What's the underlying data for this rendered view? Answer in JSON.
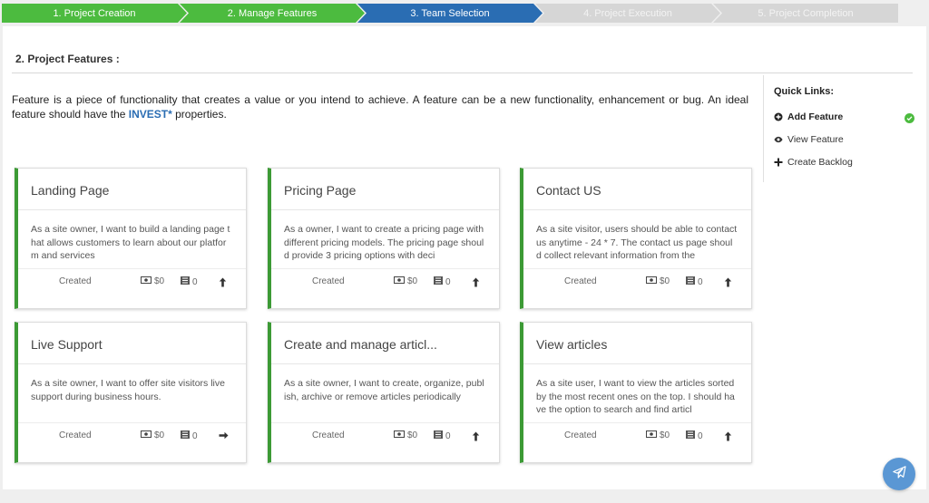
{
  "stepper": [
    {
      "label": "1. Project Creation",
      "state": "done"
    },
    {
      "label": "2. Manage Features",
      "state": "done"
    },
    {
      "label": "3. Team Selection",
      "state": "active"
    },
    {
      "label": "4. Project Execution",
      "state": "todo"
    },
    {
      "label": "5. Project Completion",
      "state": "todo"
    }
  ],
  "section": {
    "title": "2. Project Features :",
    "intro_before": "Feature is a piece of functionality that creates a value or you intend to achieve. A feature can be a new functionality, enhancement or bug. An ideal feature should have the ",
    "intro_link": "INVEST*",
    "intro_after": " properties."
  },
  "quick_links": {
    "title": "Quick Links:",
    "items": [
      {
        "label": "Add Feature",
        "icon": "plus-circle-icon",
        "checked": true
      },
      {
        "label": "View Feature",
        "icon": "eye-icon"
      },
      {
        "label": "Create Backlog",
        "icon": "plus-icon"
      }
    ]
  },
  "cards": [
    {
      "title": "Landing Page",
      "description": "As a site owner, I want to build a landing page that allows customers to learn about our platform and services",
      "status": "Created",
      "cost": "$0",
      "count": "0",
      "arrow": "up-arrow-icon"
    },
    {
      "title": "Pricing Page",
      "description": "As a owner, I want to create a pricing page with different pricing models. The pricing page should provide 3 pricing options with deci",
      "status": "Created",
      "cost": "$0",
      "count": "0",
      "arrow": "up-arrow-icon"
    },
    {
      "title": "Contact US",
      "description": "As a site visitor, users should be able to contact us anytime - 24 * 7. The contact us page should collect relevant information from the",
      "status": "Created",
      "cost": "$0",
      "count": "0",
      "arrow": "up-arrow-icon"
    },
    {
      "title": "Live Support",
      "description": "As a site owner, I want to offer site visitors live support during business hours.",
      "status": "Created",
      "cost": "$0",
      "count": "0",
      "arrow": "right-arrow-icon"
    },
    {
      "title": "Create and manage articl...",
      "description": "As a site owner, I want to create, organize, publish, archive or remove articles periodically",
      "status": "Created",
      "cost": "$0",
      "count": "0",
      "arrow": "up-arrow-icon"
    },
    {
      "title": "View articles",
      "description": "As a site user, I want to view the articles sorted by the most recent ones on the top. I should have the option to search and find articl",
      "status": "Created",
      "cost": "$0",
      "count": "0",
      "arrow": "up-arrow-icon"
    }
  ],
  "colors": {
    "done": "#4cbb3f",
    "active": "#2a6db3",
    "todo": "#d6d6d6",
    "card_accent": "#3c9a35",
    "fab": "#5a97d4"
  },
  "fab": {
    "icon": "send-icon"
  }
}
